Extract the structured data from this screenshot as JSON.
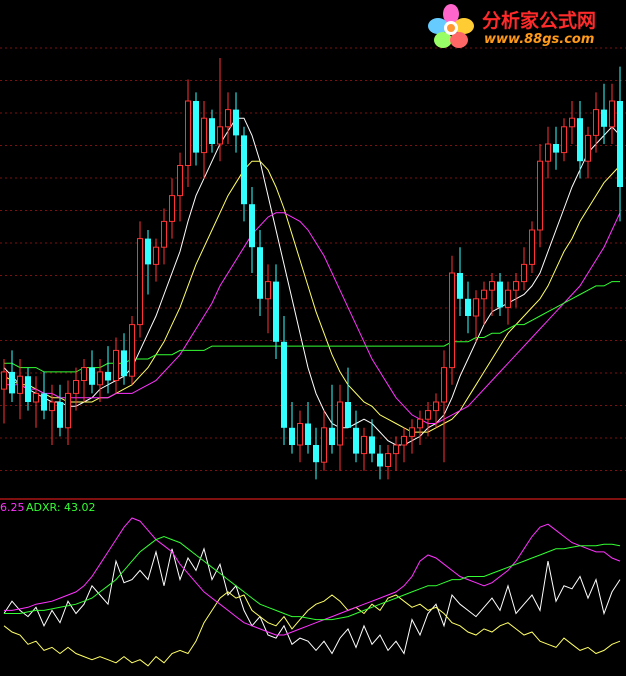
{
  "watermark": {
    "name": "分析家公式网",
    "url": "www.88gs.com"
  },
  "indicator_legend": {
    "adx_value_text": "6.25",
    "adxr_text": "ADXR: 43.02"
  },
  "colors": {
    "background": "#000000",
    "up_candle": "#ff3333",
    "down_candle": "#33ffff",
    "ma_short": "#ffffff",
    "ma_mid": "#ffff66",
    "ma_long": "#ff33ff",
    "ma_longest": "#33ff33",
    "grid": "#7a1010",
    "panel_divider": "#ff2020",
    "pdi": "#ffffff",
    "mdi": "#ffff66",
    "adx": "#ff33ff",
    "adxr": "#33ff33"
  },
  "chart_data": [
    {
      "type": "candlestick",
      "grid": true,
      "ylim": [
        0,
        100
      ],
      "candles": [
        {
          "o": 23,
          "h": 30,
          "l": 15,
          "c": 27
        },
        {
          "o": 27,
          "h": 32,
          "l": 20,
          "c": 22
        },
        {
          "o": 22,
          "h": 30,
          "l": 16,
          "c": 26
        },
        {
          "o": 26,
          "h": 28,
          "l": 18,
          "c": 20
        },
        {
          "o": 20,
          "h": 26,
          "l": 14,
          "c": 22
        },
        {
          "o": 22,
          "h": 27,
          "l": 16,
          "c": 18
        },
        {
          "o": 18,
          "h": 24,
          "l": 10,
          "c": 20
        },
        {
          "o": 20,
          "h": 24,
          "l": 12,
          "c": 14
        },
        {
          "o": 14,
          "h": 25,
          "l": 10,
          "c": 22
        },
        {
          "o": 22,
          "h": 28,
          "l": 18,
          "c": 25
        },
        {
          "o": 25,
          "h": 30,
          "l": 20,
          "c": 28
        },
        {
          "o": 28,
          "h": 32,
          "l": 22,
          "c": 24
        },
        {
          "o": 24,
          "h": 30,
          "l": 20,
          "c": 27
        },
        {
          "o": 27,
          "h": 33,
          "l": 22,
          "c": 25
        },
        {
          "o": 25,
          "h": 35,
          "l": 22,
          "c": 32
        },
        {
          "o": 32,
          "h": 36,
          "l": 24,
          "c": 26
        },
        {
          "o": 26,
          "h": 40,
          "l": 24,
          "c": 38
        },
        {
          "o": 38,
          "h": 62,
          "l": 35,
          "c": 58
        },
        {
          "o": 58,
          "h": 60,
          "l": 45,
          "c": 52
        },
        {
          "o": 52,
          "h": 58,
          "l": 48,
          "c": 56
        },
        {
          "o": 56,
          "h": 65,
          "l": 52,
          "c": 62
        },
        {
          "o": 62,
          "h": 72,
          "l": 58,
          "c": 68
        },
        {
          "o": 68,
          "h": 78,
          "l": 62,
          "c": 75
        },
        {
          "o": 75,
          "h": 95,
          "l": 70,
          "c": 90
        },
        {
          "o": 90,
          "h": 92,
          "l": 75,
          "c": 78
        },
        {
          "o": 78,
          "h": 90,
          "l": 72,
          "c": 86
        },
        {
          "o": 86,
          "h": 88,
          "l": 78,
          "c": 80
        },
        {
          "o": 80,
          "h": 100,
          "l": 76,
          "c": 84
        },
        {
          "o": 84,
          "h": 92,
          "l": 80,
          "c": 88
        },
        {
          "o": 88,
          "h": 92,
          "l": 78,
          "c": 82
        },
        {
          "o": 82,
          "h": 84,
          "l": 62,
          "c": 66
        },
        {
          "o": 66,
          "h": 70,
          "l": 50,
          "c": 56
        },
        {
          "o": 56,
          "h": 60,
          "l": 40,
          "c": 44
        },
        {
          "o": 44,
          "h": 52,
          "l": 36,
          "c": 48
        },
        {
          "o": 48,
          "h": 52,
          "l": 30,
          "c": 34
        },
        {
          "o": 34,
          "h": 40,
          "l": 10,
          "c": 14
        },
        {
          "o": 14,
          "h": 20,
          "l": 8,
          "c": 10
        },
        {
          "o": 10,
          "h": 18,
          "l": 6,
          "c": 15
        },
        {
          "o": 15,
          "h": 20,
          "l": 8,
          "c": 10
        },
        {
          "o": 10,
          "h": 14,
          "l": 2,
          "c": 6
        },
        {
          "o": 6,
          "h": 18,
          "l": 4,
          "c": 14
        },
        {
          "o": 14,
          "h": 24,
          "l": 8,
          "c": 10
        },
        {
          "o": 10,
          "h": 24,
          "l": 4,
          "c": 20
        },
        {
          "o": 20,
          "h": 28,
          "l": 16,
          "c": 14
        },
        {
          "o": 14,
          "h": 18,
          "l": 6,
          "c": 8
        },
        {
          "o": 8,
          "h": 14,
          "l": 4,
          "c": 12
        },
        {
          "o": 12,
          "h": 16,
          "l": 6,
          "c": 8
        },
        {
          "o": 8,
          "h": 10,
          "l": 2,
          "c": 5
        },
        {
          "o": 5,
          "h": 10,
          "l": 2,
          "c": 8
        },
        {
          "o": 8,
          "h": 12,
          "l": 4,
          "c": 10
        },
        {
          "o": 10,
          "h": 14,
          "l": 6,
          "c": 12
        },
        {
          "o": 12,
          "h": 16,
          "l": 8,
          "c": 14
        },
        {
          "o": 14,
          "h": 18,
          "l": 10,
          "c": 16
        },
        {
          "o": 16,
          "h": 20,
          "l": 12,
          "c": 18
        },
        {
          "o": 18,
          "h": 22,
          "l": 14,
          "c": 20
        },
        {
          "o": 20,
          "h": 32,
          "l": 6,
          "c": 28
        },
        {
          "o": 28,
          "h": 54,
          "l": 24,
          "c": 50
        },
        {
          "o": 50,
          "h": 56,
          "l": 40,
          "c": 44
        },
        {
          "o": 44,
          "h": 48,
          "l": 36,
          "c": 40
        },
        {
          "o": 40,
          "h": 46,
          "l": 34,
          "c": 44
        },
        {
          "o": 44,
          "h": 48,
          "l": 38,
          "c": 46
        },
        {
          "o": 46,
          "h": 50,
          "l": 40,
          "c": 48
        },
        {
          "o": 48,
          "h": 50,
          "l": 40,
          "c": 42
        },
        {
          "o": 42,
          "h": 48,
          "l": 38,
          "c": 46
        },
        {
          "o": 46,
          "h": 50,
          "l": 42,
          "c": 48
        },
        {
          "o": 48,
          "h": 56,
          "l": 46,
          "c": 52
        },
        {
          "o": 52,
          "h": 62,
          "l": 50,
          "c": 60
        },
        {
          "o": 60,
          "h": 80,
          "l": 56,
          "c": 76
        },
        {
          "o": 76,
          "h": 84,
          "l": 72,
          "c": 80
        },
        {
          "o": 80,
          "h": 84,
          "l": 74,
          "c": 78
        },
        {
          "o": 78,
          "h": 86,
          "l": 76,
          "c": 84
        },
        {
          "o": 84,
          "h": 90,
          "l": 80,
          "c": 86
        },
        {
          "o": 86,
          "h": 90,
          "l": 72,
          "c": 76
        },
        {
          "o": 76,
          "h": 84,
          "l": 72,
          "c": 82
        },
        {
          "o": 82,
          "h": 92,
          "l": 78,
          "c": 88
        },
        {
          "o": 88,
          "h": 94,
          "l": 80,
          "c": 84
        },
        {
          "o": 84,
          "h": 94,
          "l": 80,
          "c": 90
        },
        {
          "o": 90,
          "h": 98,
          "l": 62,
          "c": 70
        }
      ],
      "lines": [
        {
          "color_key": "ma_short",
          "values": [
            28,
            26,
            24,
            23,
            22,
            21,
            20,
            20,
            19,
            19,
            20,
            21,
            23,
            24,
            25,
            26,
            28,
            32,
            36,
            40,
            45,
            50,
            55,
            62,
            68,
            72,
            76,
            80,
            83,
            86,
            86,
            82,
            76,
            68,
            60,
            52,
            44,
            36,
            28,
            22,
            18,
            15,
            14,
            14,
            15,
            16,
            15,
            13,
            11,
            10,
            10,
            11,
            12,
            14,
            15,
            17,
            21,
            26,
            30,
            34,
            38,
            41,
            42,
            43,
            44,
            45,
            47,
            50,
            55,
            60,
            65,
            70,
            74,
            78,
            80,
            82,
            84,
            82
          ]
        },
        {
          "color_key": "ma_mid",
          "values": [
            26,
            25,
            24,
            24,
            23,
            22,
            21,
            21,
            20,
            20,
            20,
            20,
            21,
            21,
            22,
            23,
            24,
            26,
            28,
            31,
            34,
            38,
            42,
            47,
            52,
            56,
            60,
            64,
            68,
            71,
            74,
            76,
            76,
            74,
            70,
            65,
            59,
            53,
            47,
            41,
            36,
            31,
            27,
            24,
            22,
            20,
            19,
            17,
            16,
            15,
            14,
            13,
            13,
            13,
            14,
            15,
            16,
            18,
            21,
            24,
            27,
            30,
            33,
            36,
            38,
            40,
            42,
            44,
            47,
            51,
            55,
            58,
            62,
            65,
            68,
            71,
            73,
            75
          ]
        },
        {
          "color_key": "ma_long",
          "values": [
            24,
            24,
            24,
            23,
            23,
            22,
            22,
            21,
            21,
            21,
            21,
            21,
            21,
            21,
            22,
            22,
            22,
            23,
            24,
            25,
            27,
            29,
            31,
            34,
            37,
            40,
            43,
            47,
            50,
            53,
            56,
            59,
            61,
            63,
            64,
            64,
            63,
            62,
            60,
            57,
            54,
            50,
            46,
            42,
            38,
            34,
            30,
            27,
            24,
            21,
            19,
            17,
            16,
            15,
            15,
            16,
            17,
            18,
            19,
            21,
            23,
            25,
            27,
            29,
            31,
            33,
            35,
            37,
            39,
            41,
            43,
            45,
            47,
            50,
            53,
            56,
            60,
            64
          ]
        },
        {
          "color_key": "ma_longest",
          "values": [
            29,
            29,
            28,
            28,
            28,
            27,
            27,
            27,
            27,
            27,
            28,
            28,
            28,
            29,
            29,
            29,
            30,
            30,
            30,
            31,
            31,
            31,
            32,
            32,
            32,
            32,
            33,
            33,
            33,
            33,
            33,
            33,
            33,
            33,
            33,
            33,
            33,
            33,
            33,
            33,
            33,
            33,
            33,
            33,
            33,
            33,
            33,
            33,
            33,
            33,
            33,
            33,
            33,
            33,
            33,
            33,
            34,
            34,
            34,
            35,
            35,
            36,
            36,
            37,
            38,
            38,
            39,
            40,
            41,
            42,
            43,
            44,
            45,
            46,
            47,
            47,
            48,
            48
          ]
        }
      ]
    },
    {
      "type": "line",
      "grid": false,
      "ylim": [
        0,
        100
      ],
      "series": [
        {
          "color_key": "pdi",
          "values": [
            38,
            46,
            40,
            36,
            42,
            30,
            40,
            32,
            46,
            38,
            44,
            56,
            50,
            44,
            72,
            58,
            60,
            66,
            60,
            78,
            56,
            80,
            60,
            74,
            66,
            80,
            60,
            70,
            50,
            56,
            40,
            30,
            36,
            24,
            22,
            30,
            18,
            22,
            20,
            14,
            20,
            12,
            22,
            28,
            16,
            30,
            18,
            24,
            14,
            20,
            12,
            34,
            24,
            38,
            44,
            30,
            50,
            44,
            40,
            36,
            42,
            48,
            40,
            56,
            38,
            44,
            50,
            40,
            72,
            46,
            56,
            54,
            62,
            48,
            60,
            38,
            52,
            60
          ]
        },
        {
          "color_key": "mdi",
          "values": [
            30,
            26,
            24,
            18,
            20,
            14,
            16,
            12,
            16,
            12,
            10,
            8,
            10,
            8,
            6,
            10,
            6,
            8,
            4,
            10,
            6,
            12,
            14,
            12,
            20,
            32,
            40,
            48,
            52,
            48,
            50,
            40,
            36,
            32,
            30,
            36,
            28,
            34,
            40,
            44,
            46,
            50,
            46,
            40,
            42,
            38,
            44,
            40,
            48,
            50,
            46,
            42,
            44,
            40,
            42,
            38,
            32,
            30,
            26,
            24,
            28,
            26,
            30,
            32,
            28,
            24,
            26,
            20,
            18,
            16,
            22,
            18,
            14,
            16,
            12,
            14,
            18,
            20
          ]
        },
        {
          "color_key": "adx",
          "values": [
            40,
            40,
            41,
            42,
            44,
            45,
            46,
            48,
            50,
            52,
            56,
            62,
            70,
            78,
            86,
            94,
            100,
            98,
            92,
            86,
            82,
            78,
            70,
            64,
            58,
            52,
            48,
            44,
            40,
            36,
            32,
            30,
            28,
            26,
            24,
            24,
            26,
            28,
            30,
            32,
            34,
            36,
            38,
            40,
            42,
            44,
            46,
            48,
            50,
            52,
            56,
            62,
            72,
            76,
            74,
            70,
            66,
            62,
            60,
            58,
            56,
            58,
            62,
            66,
            72,
            80,
            88,
            94,
            96,
            92,
            88,
            84,
            82,
            80,
            78,
            78,
            74,
            72
          ]
        },
        {
          "color_key": "adxr",
          "values": [
            38,
            38,
            38,
            39,
            40,
            40,
            41,
            42,
            43,
            44,
            46,
            48,
            52,
            56,
            60,
            66,
            72,
            78,
            82,
            86,
            88,
            86,
            84,
            80,
            76,
            72,
            68,
            64,
            60,
            56,
            52,
            48,
            44,
            42,
            40,
            38,
            36,
            36,
            35,
            34,
            34,
            34,
            35,
            36,
            38,
            40,
            42,
            44,
            46,
            48,
            50,
            52,
            54,
            56,
            56,
            58,
            60,
            60,
            62,
            62,
            62,
            64,
            66,
            68,
            70,
            72,
            74,
            76,
            78,
            80,
            80,
            81,
            82,
            82,
            82,
            83,
            83,
            82
          ]
        }
      ]
    }
  ]
}
